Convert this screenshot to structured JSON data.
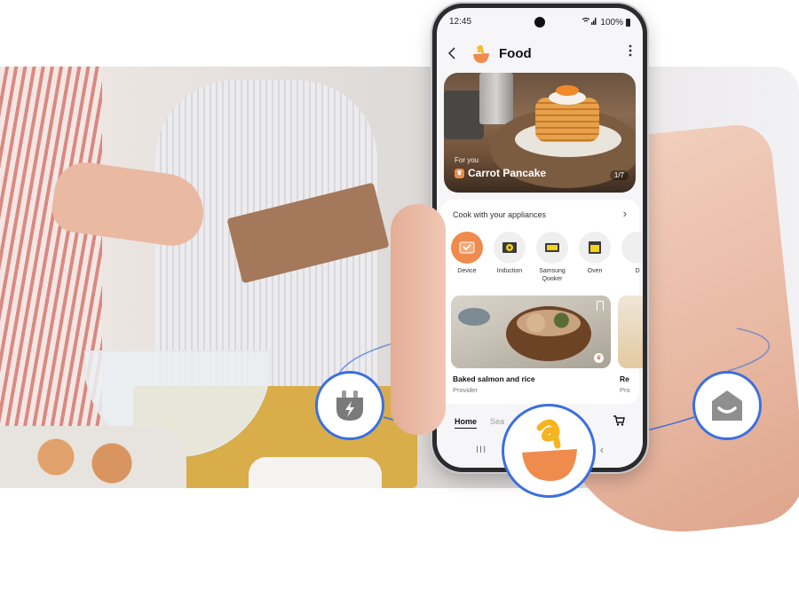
{
  "phone": {
    "status_bar": {
      "time": "12:45",
      "signal_icon": "wifi-signal-icon",
      "battery": "100%"
    },
    "app_bar": {
      "back_icon": "chevron-left-icon",
      "title": "Food",
      "more_icon": "more-vertical-icon"
    },
    "hero": {
      "subtitle": "For you",
      "title": "Carrot Pancake",
      "pager": "1/7"
    },
    "appliances": {
      "heading": "Cook with your appliances",
      "chevron": "›",
      "items": [
        {
          "label": "Device",
          "icon": "device-icon",
          "selected": true
        },
        {
          "label": "Induction",
          "icon": "induction-icon",
          "selected": false
        },
        {
          "label": "Samsung Qooker",
          "icon": "qooker-icon",
          "selected": false
        },
        {
          "label": "Oven",
          "icon": "oven-icon",
          "selected": false
        },
        {
          "label": "D",
          "icon": "appliance-icon",
          "selected": false
        }
      ]
    },
    "recipes": [
      {
        "title": "Baked salmon and rice",
        "provider": "Provider"
      },
      {
        "title": "Re",
        "provider": "Pro"
      }
    ],
    "tabs": [
      {
        "label": "Home",
        "active": true
      },
      {
        "label": "Sea",
        "active": false
      }
    ],
    "nav": {
      "recents": "III",
      "back": "‹"
    }
  },
  "badges": {
    "left": "smart-plug-icon",
    "center": "samsung-food-logo-icon",
    "right": "smartthings-home-icon"
  },
  "colors": {
    "accent_orange": "#ef8b4d",
    "logo_yellow": "#f6b51e",
    "connection_blue": "#3b6fe0"
  }
}
